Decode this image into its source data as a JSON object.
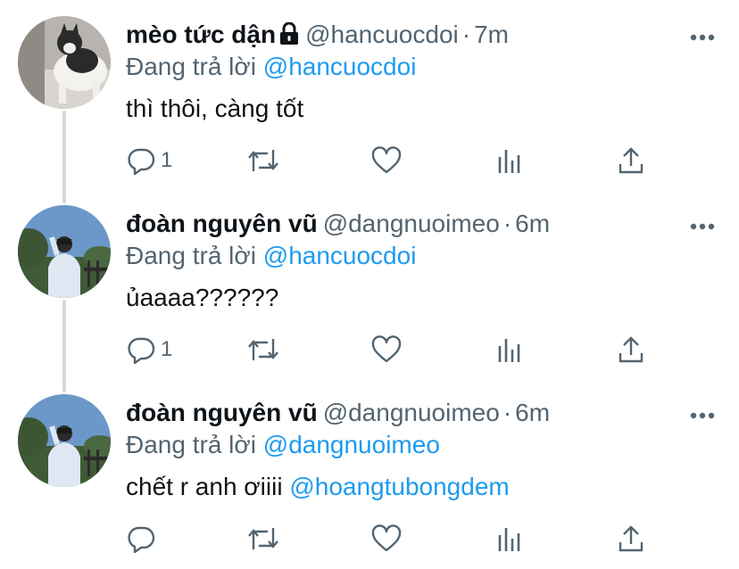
{
  "tweets": [
    {
      "name": "mèo tức dận",
      "protected": true,
      "handle": "@hancuocdoi",
      "time": "7m",
      "replying_prefix": "Đang trả lời",
      "replying_to": "@hancuocdoi",
      "text": "thì thôi, càng tốt",
      "text_mention": "",
      "reply_count": "1",
      "avatar": "cat-avatar"
    },
    {
      "name": "đoàn nguyên vũ",
      "protected": false,
      "handle": "@dangnuoimeo",
      "time": "6m",
      "replying_prefix": "Đang trả lời",
      "replying_to": "@hancuocdoi",
      "text": "ủaaaa??????",
      "text_mention": "",
      "reply_count": "1",
      "avatar": "person-avatar"
    },
    {
      "name": "đoàn nguyên vũ",
      "protected": false,
      "handle": "@dangnuoimeo",
      "time": "6m",
      "replying_prefix": "Đang trả lời",
      "replying_to": "@dangnuoimeo",
      "text": "chết r anh ơiiii",
      "text_mention": "@hoangtubongdem",
      "reply_count": "",
      "avatar": "person-avatar"
    }
  ],
  "colors": {
    "link": "#1d9bf0",
    "secondary": "#536471",
    "thread_line": "#cfd9de"
  }
}
